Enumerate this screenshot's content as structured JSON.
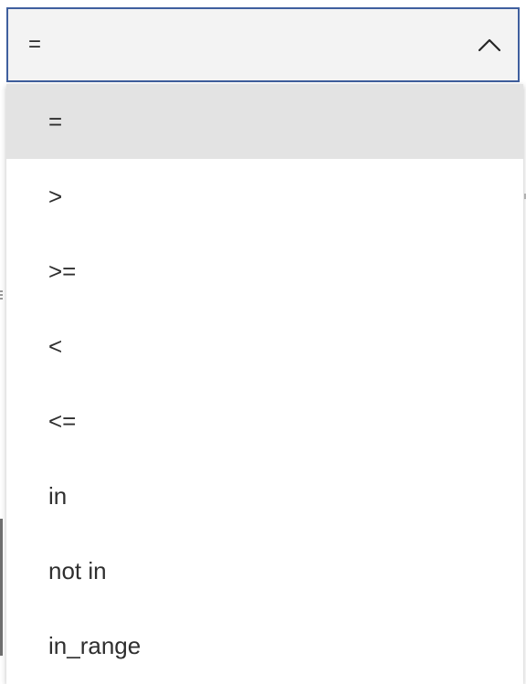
{
  "dropdown": {
    "selected_value": "=",
    "expanded": true,
    "border_color": "#3f5f9e",
    "field_background": "#f3f3f3",
    "highlight_background": "#e3e3e3",
    "toggle_icon": "chevron-up-icon",
    "options": [
      {
        "label": "="
      },
      {
        "label": ">"
      },
      {
        "label": ">="
      },
      {
        "label": "<"
      },
      {
        "label": "<="
      },
      {
        "label": "in"
      },
      {
        "label": "not in"
      },
      {
        "label": "in_range"
      }
    ]
  }
}
